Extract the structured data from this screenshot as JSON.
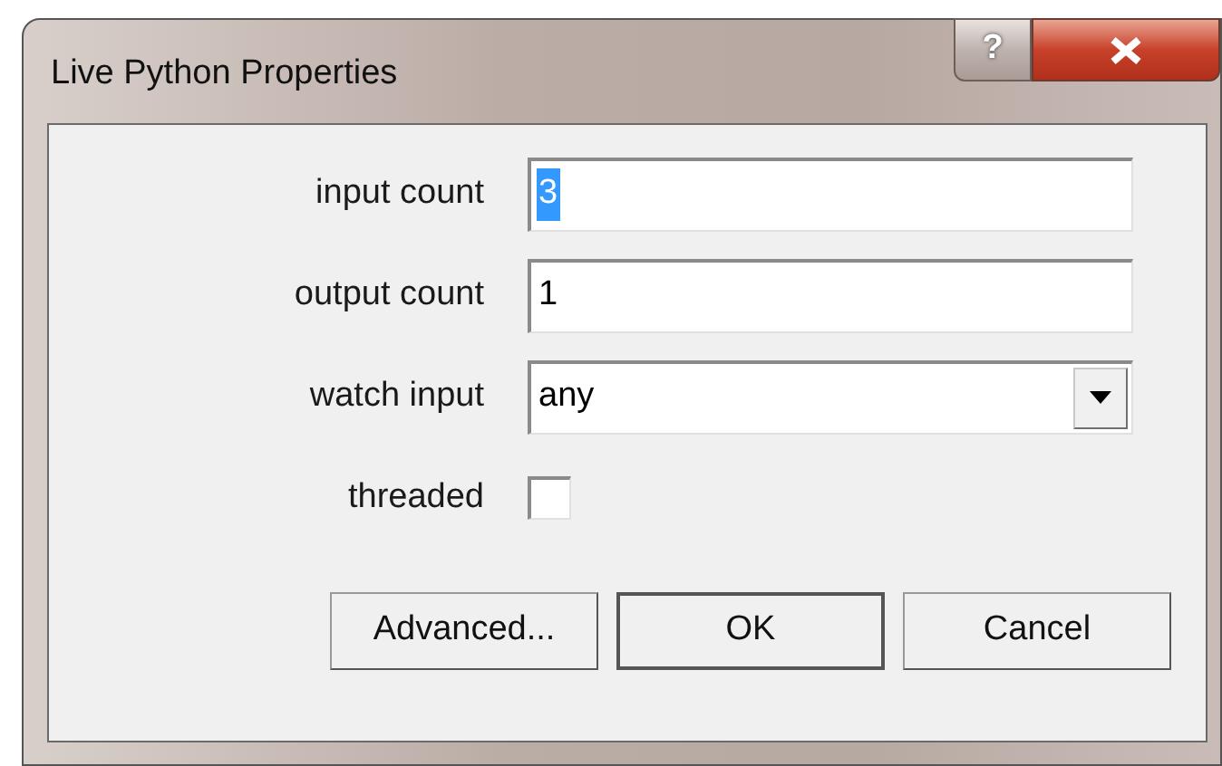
{
  "window": {
    "title": "Live Python Properties",
    "help_label": "?"
  },
  "fields": [
    {
      "kind": "text",
      "label": "input count",
      "value": "3",
      "value_selected": true
    },
    {
      "kind": "text",
      "label": "output count",
      "value": "1",
      "value_selected": false
    },
    {
      "kind": "dropdown",
      "label": "watch input",
      "value": "any"
    },
    {
      "kind": "checkbox",
      "label": "threaded",
      "checked": false
    }
  ],
  "buttons": [
    {
      "label": "Advanced...",
      "default": false
    },
    {
      "label": "OK",
      "default": true
    },
    {
      "label": "Cancel",
      "default": false
    }
  ]
}
